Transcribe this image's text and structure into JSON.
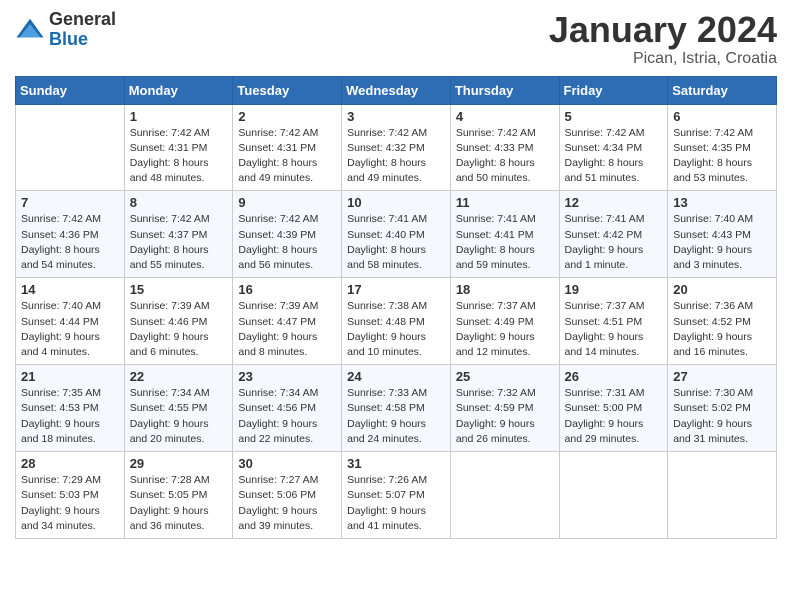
{
  "header": {
    "logo_general": "General",
    "logo_blue": "Blue",
    "title": "January 2024",
    "location": "Pican, Istria, Croatia"
  },
  "weekdays": [
    "Sunday",
    "Monday",
    "Tuesday",
    "Wednesday",
    "Thursday",
    "Friday",
    "Saturday"
  ],
  "weeks": [
    [
      {
        "day": "",
        "info": ""
      },
      {
        "day": "1",
        "info": "Sunrise: 7:42 AM\nSunset: 4:31 PM\nDaylight: 8 hours\nand 48 minutes."
      },
      {
        "day": "2",
        "info": "Sunrise: 7:42 AM\nSunset: 4:31 PM\nDaylight: 8 hours\nand 49 minutes."
      },
      {
        "day": "3",
        "info": "Sunrise: 7:42 AM\nSunset: 4:32 PM\nDaylight: 8 hours\nand 49 minutes."
      },
      {
        "day": "4",
        "info": "Sunrise: 7:42 AM\nSunset: 4:33 PM\nDaylight: 8 hours\nand 50 minutes."
      },
      {
        "day": "5",
        "info": "Sunrise: 7:42 AM\nSunset: 4:34 PM\nDaylight: 8 hours\nand 51 minutes."
      },
      {
        "day": "6",
        "info": "Sunrise: 7:42 AM\nSunset: 4:35 PM\nDaylight: 8 hours\nand 53 minutes."
      }
    ],
    [
      {
        "day": "7",
        "info": "Sunrise: 7:42 AM\nSunset: 4:36 PM\nDaylight: 8 hours\nand 54 minutes."
      },
      {
        "day": "8",
        "info": "Sunrise: 7:42 AM\nSunset: 4:37 PM\nDaylight: 8 hours\nand 55 minutes."
      },
      {
        "day": "9",
        "info": "Sunrise: 7:42 AM\nSunset: 4:39 PM\nDaylight: 8 hours\nand 56 minutes."
      },
      {
        "day": "10",
        "info": "Sunrise: 7:41 AM\nSunset: 4:40 PM\nDaylight: 8 hours\nand 58 minutes."
      },
      {
        "day": "11",
        "info": "Sunrise: 7:41 AM\nSunset: 4:41 PM\nDaylight: 8 hours\nand 59 minutes."
      },
      {
        "day": "12",
        "info": "Sunrise: 7:41 AM\nSunset: 4:42 PM\nDaylight: 9 hours\nand 1 minute."
      },
      {
        "day": "13",
        "info": "Sunrise: 7:40 AM\nSunset: 4:43 PM\nDaylight: 9 hours\nand 3 minutes."
      }
    ],
    [
      {
        "day": "14",
        "info": "Sunrise: 7:40 AM\nSunset: 4:44 PM\nDaylight: 9 hours\nand 4 minutes."
      },
      {
        "day": "15",
        "info": "Sunrise: 7:39 AM\nSunset: 4:46 PM\nDaylight: 9 hours\nand 6 minutes."
      },
      {
        "day": "16",
        "info": "Sunrise: 7:39 AM\nSunset: 4:47 PM\nDaylight: 9 hours\nand 8 minutes."
      },
      {
        "day": "17",
        "info": "Sunrise: 7:38 AM\nSunset: 4:48 PM\nDaylight: 9 hours\nand 10 minutes."
      },
      {
        "day": "18",
        "info": "Sunrise: 7:37 AM\nSunset: 4:49 PM\nDaylight: 9 hours\nand 12 minutes."
      },
      {
        "day": "19",
        "info": "Sunrise: 7:37 AM\nSunset: 4:51 PM\nDaylight: 9 hours\nand 14 minutes."
      },
      {
        "day": "20",
        "info": "Sunrise: 7:36 AM\nSunset: 4:52 PM\nDaylight: 9 hours\nand 16 minutes."
      }
    ],
    [
      {
        "day": "21",
        "info": "Sunrise: 7:35 AM\nSunset: 4:53 PM\nDaylight: 9 hours\nand 18 minutes."
      },
      {
        "day": "22",
        "info": "Sunrise: 7:34 AM\nSunset: 4:55 PM\nDaylight: 9 hours\nand 20 minutes."
      },
      {
        "day": "23",
        "info": "Sunrise: 7:34 AM\nSunset: 4:56 PM\nDaylight: 9 hours\nand 22 minutes."
      },
      {
        "day": "24",
        "info": "Sunrise: 7:33 AM\nSunset: 4:58 PM\nDaylight: 9 hours\nand 24 minutes."
      },
      {
        "day": "25",
        "info": "Sunrise: 7:32 AM\nSunset: 4:59 PM\nDaylight: 9 hours\nand 26 minutes."
      },
      {
        "day": "26",
        "info": "Sunrise: 7:31 AM\nSunset: 5:00 PM\nDaylight: 9 hours\nand 29 minutes."
      },
      {
        "day": "27",
        "info": "Sunrise: 7:30 AM\nSunset: 5:02 PM\nDaylight: 9 hours\nand 31 minutes."
      }
    ],
    [
      {
        "day": "28",
        "info": "Sunrise: 7:29 AM\nSunset: 5:03 PM\nDaylight: 9 hours\nand 34 minutes."
      },
      {
        "day": "29",
        "info": "Sunrise: 7:28 AM\nSunset: 5:05 PM\nDaylight: 9 hours\nand 36 minutes."
      },
      {
        "day": "30",
        "info": "Sunrise: 7:27 AM\nSunset: 5:06 PM\nDaylight: 9 hours\nand 39 minutes."
      },
      {
        "day": "31",
        "info": "Sunrise: 7:26 AM\nSunset: 5:07 PM\nDaylight: 9 hours\nand 41 minutes."
      },
      {
        "day": "",
        "info": ""
      },
      {
        "day": "",
        "info": ""
      },
      {
        "day": "",
        "info": ""
      }
    ]
  ]
}
